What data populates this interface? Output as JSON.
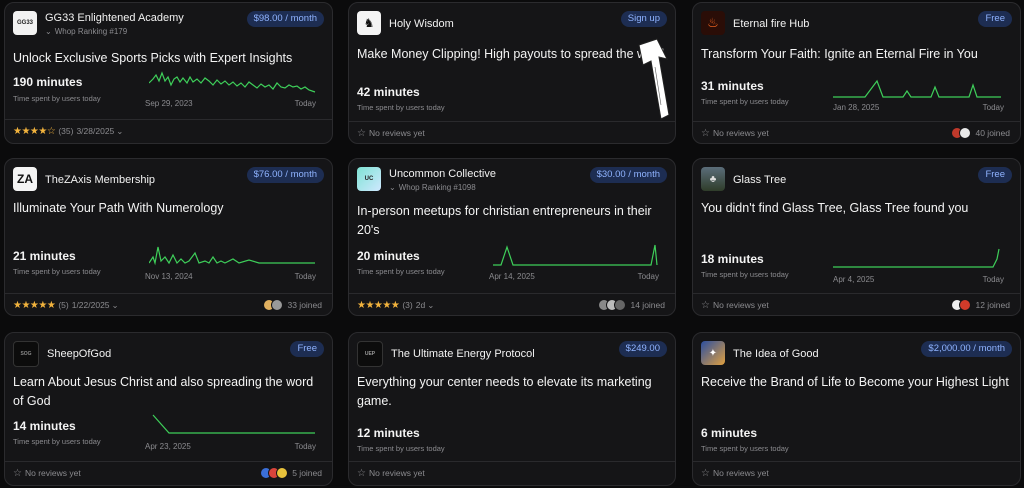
{
  "cards": [
    {
      "name": "GG33 Enlightened Academy",
      "rank": "Whop Ranking #179",
      "price": "$98.00 / month",
      "title": "Unlock Exclusive Sports Picks with Expert Insights",
      "minutes": "190 minutes",
      "minutes_label": "Time spent by users today",
      "date_start": "Sep 29, 2023",
      "date_end": "Today",
      "rating": "(35)",
      "review_date": "3/28/2025",
      "reviews_text": "",
      "joined": ""
    },
    {
      "name": "Holy Wisdom",
      "rank": "",
      "price": "Sign up",
      "title": "Make Money Clipping! High payouts to spread the word",
      "minutes": "42 minutes",
      "minutes_label": "Time spent by users today",
      "date_start": "",
      "date_end": "",
      "rating": "",
      "review_date": "",
      "reviews_text": "No reviews yet",
      "joined": ""
    },
    {
      "name": "Eternal fire Hub",
      "rank": "",
      "price": "Free",
      "title": "Transform Your Faith: Ignite an Eternal Fire in You",
      "minutes": "31 minutes",
      "minutes_label": "Time spent by users today",
      "date_start": "Jan 28, 2025",
      "date_end": "Today",
      "rating": "",
      "review_date": "",
      "reviews_text": "No reviews yet",
      "joined": "40 joined"
    },
    {
      "name": "TheZAxis Membership",
      "rank": "",
      "price": "$76.00 / month",
      "title": "Illuminate Your Path With Numerology",
      "minutes": "21 minutes",
      "minutes_label": "Time spent by users today",
      "date_start": "Nov 13, 2024",
      "date_end": "Today",
      "rating": "(5)",
      "review_date": "1/22/2025",
      "reviews_text": "",
      "joined": "33 joined"
    },
    {
      "name": "Uncommon Collective",
      "rank": "Whop Ranking #1098",
      "price": "$30.00 / month",
      "title": "In-person meetups for christian entrepreneurs in their 20's",
      "minutes": "20 minutes",
      "minutes_label": "Time spent by users today",
      "date_start": "Apr 14, 2025",
      "date_end": "Today",
      "rating": "(3)",
      "review_date": "2d",
      "reviews_text": "",
      "joined": "14 joined"
    },
    {
      "name": "Glass Tree",
      "rank": "",
      "price": "Free",
      "title": "You didn't find Glass Tree, Glass Tree found you",
      "minutes": "18 minutes",
      "minutes_label": "Time spent by users today",
      "date_start": "Apr 4, 2025",
      "date_end": "Today",
      "rating": "",
      "review_date": "",
      "reviews_text": "No reviews yet",
      "joined": "12 joined"
    },
    {
      "name": "SheepOfGod",
      "rank": "",
      "price": "Free",
      "title": "Learn About Jesus Christ and also spreading the word of God",
      "minutes": "14 minutes",
      "minutes_label": "Time spent by users today",
      "date_start": "Apr 23, 2025",
      "date_end": "Today",
      "rating": "",
      "review_date": "",
      "reviews_text": "No reviews yet",
      "joined": "5 joined"
    },
    {
      "name": "The Ultimate Energy Protocol",
      "rank": "",
      "price": "$249.00",
      "title": "Everything your center needs to elevate its marketing game.",
      "minutes": "12 minutes",
      "minutes_label": "Time spent by users today",
      "date_start": "",
      "date_end": "",
      "rating": "",
      "review_date": "",
      "reviews_text": "No reviews yet",
      "joined": ""
    },
    {
      "name": "The Idea of Good",
      "rank": "",
      "price": "$2,000.00 / month",
      "title": "Receive the Brand of Life to Become your Highest Light",
      "minutes": "6 minutes",
      "minutes_label": "Time spent by users today",
      "date_start": "",
      "date_end": "",
      "rating": "",
      "review_date": "",
      "reviews_text": "No reviews yet",
      "joined": ""
    }
  ],
  "colors": {
    "accent_green": "#3ecf5a",
    "price_text": "#8fb3ff",
    "price_bg": "#1d2d52",
    "star": "#f2b33d"
  },
  "icons": [
    "chevron-down-icon",
    "star-icon",
    "star-outline-icon",
    "arrow-annotation-icon"
  ]
}
